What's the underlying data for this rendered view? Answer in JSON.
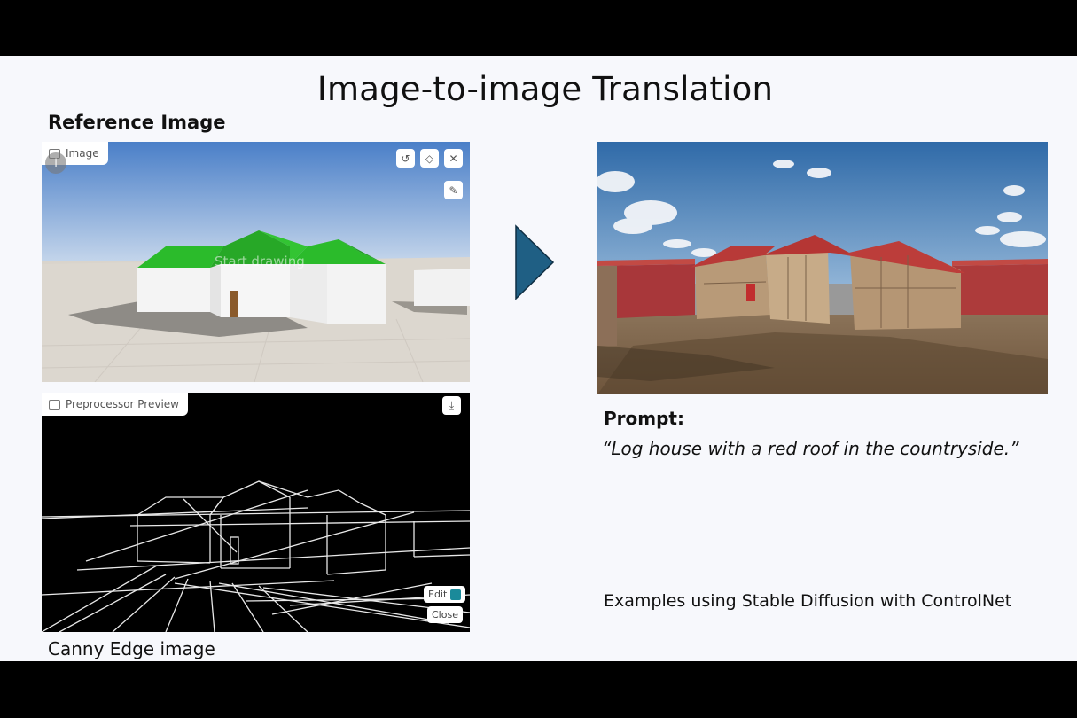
{
  "slide": {
    "title": "Image-to-image Translation",
    "reference_label": "Reference Image",
    "canny_label": "Canny Edge image",
    "prompt_heading": "Prompt:",
    "prompt_text": "“Log house with a red roof in the countryside.”",
    "footnote": "Examples using Stable Diffusion with ControlNet"
  },
  "image_panel": {
    "tag_label": "Image",
    "info_badge": "i",
    "overlay_hint": "Start drawing",
    "tools": [
      "undo-icon",
      "eraser-icon",
      "close-icon",
      "brush-icon"
    ]
  },
  "preprocessor_panel": {
    "tag_label": "Preprocessor Preview",
    "download_icon": "download-icon",
    "edit_label": "Edit",
    "close_label": "Close"
  },
  "colors": {
    "arrow": "#1f5f84",
    "roof_green": "#2bbb2b",
    "result_roof_red": "#b83a38"
  }
}
